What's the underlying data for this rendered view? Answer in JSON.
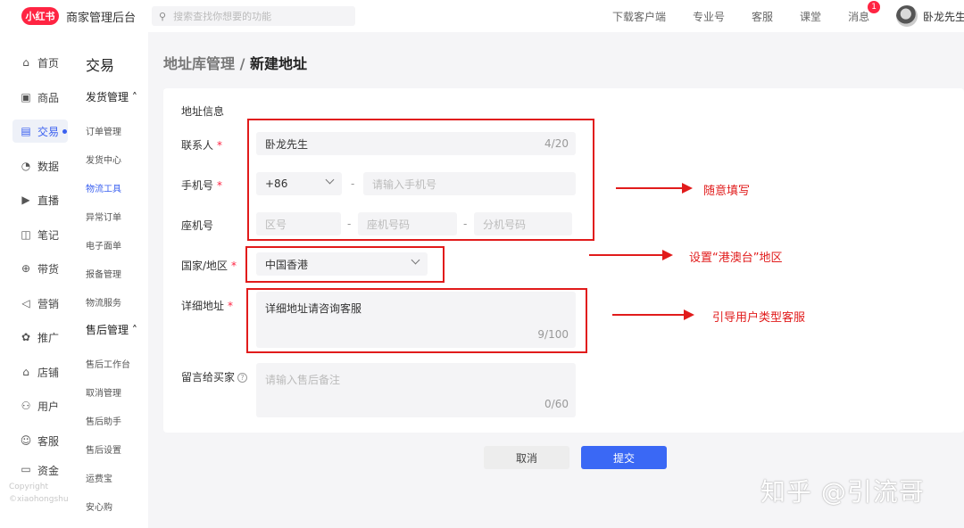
{
  "topbar": {
    "logo": "小红书",
    "title": "商家管理后台",
    "search_placeholder": "搜索查找你想要的功能",
    "nav": [
      "下载客户端",
      "专业号",
      "客服",
      "课堂",
      "消息"
    ],
    "message_badge": "1",
    "user_name": "卧龙先生"
  },
  "sidebar": {
    "items": [
      {
        "label": "首页",
        "icon": "⌂"
      },
      {
        "label": "商品",
        "icon": "▣"
      },
      {
        "label": "交易",
        "icon": "▤"
      },
      {
        "label": "数据",
        "icon": "◔"
      },
      {
        "label": "直播",
        "icon": "▶"
      },
      {
        "label": "笔记",
        "icon": "◫"
      },
      {
        "label": "带货",
        "icon": "⊕"
      },
      {
        "label": "营销",
        "icon": "◁"
      },
      {
        "label": "推广",
        "icon": "✿"
      },
      {
        "label": "店铺",
        "icon": "⌂"
      },
      {
        "label": "用户",
        "icon": "⚇"
      },
      {
        "label": "客服",
        "icon": "☺"
      },
      {
        "label": "资金",
        "icon": "▭"
      }
    ],
    "copyright_1": "Copyright",
    "copyright_2": "©xiaohongshu"
  },
  "subnav": {
    "title": "交易",
    "group1": "发货管理 ˄",
    "group1_items": [
      "订单管理",
      "发货中心",
      "物流工具",
      "异常订单",
      "电子面单",
      "报备管理",
      "物流服务"
    ],
    "group2": "售后管理 ˄",
    "group2_items": [
      "售后工作台",
      "取消管理",
      "售后助手",
      "售后设置",
      "运费宝",
      "安心购"
    ]
  },
  "breadcrumb": {
    "parent": "地址库管理",
    "sep": " / ",
    "current": "新建地址"
  },
  "form": {
    "section_title": "地址信息",
    "contact_label": "联系人",
    "contact_value": "卧龙先生",
    "contact_counter": "4/20",
    "phone_label": "手机号",
    "phone_code": "+86",
    "phone_placeholder": "请输入手机号",
    "landline_label": "座机号",
    "area_placeholder": "区号",
    "landline_placeholder": "座机号码",
    "ext_placeholder": "分机号码",
    "dash": "-",
    "region_label": "国家/地区",
    "region_value": "中国香港",
    "address_label": "详细地址",
    "address_value": "详细地址请咨询客服",
    "address_counter": "9/100",
    "message_label": "留言给买家",
    "message_placeholder": "请输入售后备注",
    "message_counter": "0/60",
    "required_mark": "*",
    "help_mark": "?"
  },
  "annotations": {
    "note1": "随意填写",
    "note2": "设置“港澳台”地区",
    "note3": "引导用户类型客服"
  },
  "buttons": {
    "cancel": "取消",
    "submit": "提交"
  },
  "watermark": "知乎 @引流哥"
}
